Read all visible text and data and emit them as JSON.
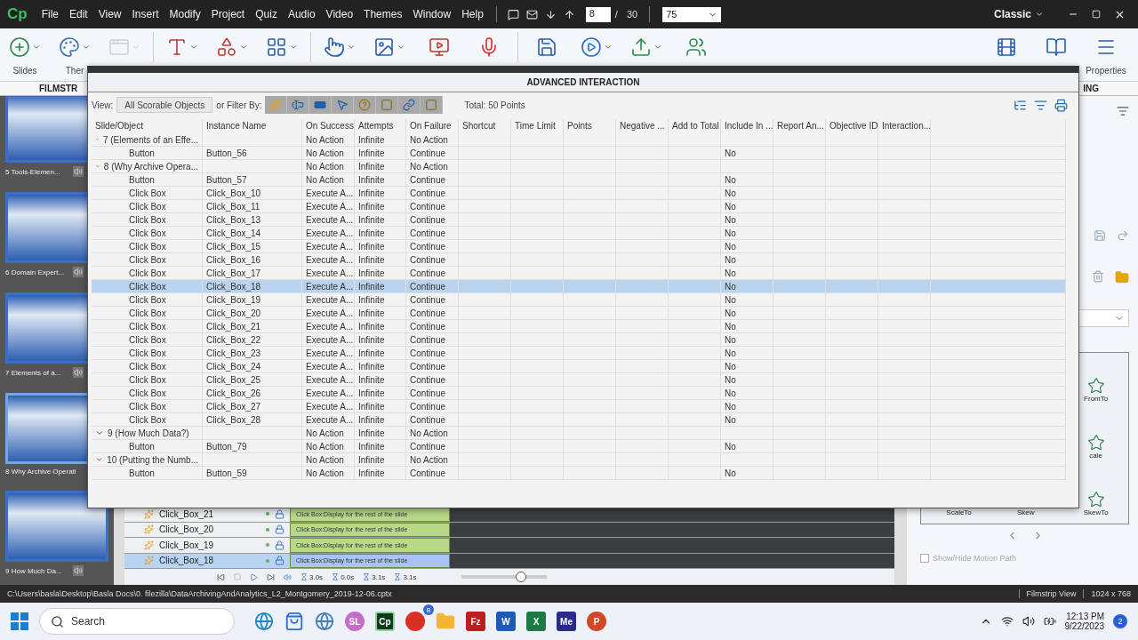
{
  "menu_bar": {
    "logo": "Cp",
    "menus": [
      "File",
      "Edit",
      "View",
      "Insert",
      "Modify",
      "Project",
      "Quiz",
      "Audio",
      "Video",
      "Themes",
      "Window",
      "Help"
    ],
    "page": "8",
    "page_separator": "/",
    "page_total": "30",
    "zoom": "75",
    "workspace": "Classic"
  },
  "toolbar": {
    "items": [
      {
        "kind": "slides",
        "label": "Slides",
        "caret": true,
        "disabled": false
      },
      {
        "kind": "themes",
        "label": "Ther",
        "caret": true,
        "disabled": false
      },
      {
        "kind": "window",
        "caret": true,
        "disabled": true
      },
      {
        "kind": "text",
        "caret": true,
        "disabled": false
      },
      {
        "kind": "shapes",
        "caret": true,
        "disabled": false
      },
      {
        "kind": "grid",
        "caret": true,
        "disabled": false
      },
      {
        "kind": "interactions",
        "caret": true,
        "disabled": false
      },
      {
        "kind": "media",
        "caret": true,
        "disabled": false
      },
      {
        "kind": "video",
        "caret": false,
        "disabled": false
      },
      {
        "kind": "audio",
        "caret": false,
        "disabled": false
      },
      {
        "kind": "save",
        "caret": false,
        "disabled": false
      },
      {
        "kind": "preview",
        "caret": true,
        "disabled": false
      },
      {
        "kind": "publish",
        "caret": true,
        "disabled": false
      },
      {
        "kind": "share",
        "caret": false,
        "disabled": false
      }
    ],
    "right_items": [
      {
        "kind": "library"
      },
      {
        "kind": "assets"
      },
      {
        "kind": "properties",
        "label": "Properties"
      }
    ]
  },
  "panel_headers": {
    "left": "FILMSTR",
    "right": "ING"
  },
  "filmstrip": [
    {
      "label": "5 Tools-Elemen...",
      "selected": false,
      "speaker": true
    },
    {
      "label": "6 Domain Expert...",
      "selected": false,
      "speaker": true
    },
    {
      "label": "7 Elements of a...",
      "selected": false,
      "speaker": true
    },
    {
      "label": "8 Why Archive Operati",
      "selected": true,
      "speaker": false
    },
    {
      "label": "9 How Much Da...",
      "selected": false,
      "speaker": true
    }
  ],
  "dialog": {
    "title": "ADVANCED INTERACTION",
    "view_label": "View:",
    "view_value": "All Scorable Objects",
    "filter_label": "or Filter By:",
    "filters": [
      {
        "kind": "click"
      },
      {
        "kind": "field"
      },
      {
        "kind": "button"
      },
      {
        "kind": "rollover"
      },
      {
        "kind": "question"
      },
      {
        "kind": "frame"
      },
      {
        "kind": "link"
      },
      {
        "kind": "frame"
      }
    ],
    "total": "Total: 50 Points",
    "columns": [
      "Slide/Object",
      "Instance Name",
      "On Success",
      "Attempts",
      "On Failure",
      "Shortcut",
      "Time Limit",
      "Points",
      "Negative ...",
      "Add to Total",
      "Include In ...",
      "Report An...",
      "Objective ID",
      "Interaction..."
    ],
    "groups": [
      {
        "label": "7 (Elements of an Effe...",
        "on_success": "No Action",
        "attempts": "Infinite",
        "on_failure": "No Action",
        "expanded": true,
        "children": [
          {
            "object": "Button",
            "instance": "Button_56",
            "on_success": "No Action",
            "attempts": "Infinite",
            "on_failure": "Continue",
            "include_in": "No",
            "selected": false
          }
        ]
      },
      {
        "label": "8 (Why Archive Opera...",
        "on_success": "No Action",
        "attempts": "Infinite",
        "on_failure": "No Action",
        "expanded": true,
        "children": [
          {
            "object": "Button",
            "instance": "Button_57",
            "on_success": "No Action",
            "attempts": "Infinite",
            "on_failure": "Continue",
            "include_in": "No",
            "selected": false
          },
          {
            "object": "Click Box",
            "instance": "Click_Box_10",
            "on_success": "Execute A...",
            "attempts": "Infinite",
            "on_failure": "Continue",
            "include_in": "No",
            "selected": false
          },
          {
            "object": "Click Box",
            "instance": "Click_Box_11",
            "on_success": "Execute A...",
            "attempts": "Infinite",
            "on_failure": "Continue",
            "include_in": "No",
            "selected": false
          },
          {
            "object": "Click Box",
            "instance": "Click_Box_13",
            "on_success": "Execute A...",
            "attempts": "Infinite",
            "on_failure": "Continue",
            "include_in": "No",
            "selected": false
          },
          {
            "object": "Click Box",
            "instance": "Click_Box_14",
            "on_success": "Execute A...",
            "attempts": "Infinite",
            "on_failure": "Continue",
            "include_in": "No",
            "selected": false
          },
          {
            "object": "Click Box",
            "instance": "Click_Box_15",
            "on_success": "Execute A...",
            "attempts": "Infinite",
            "on_failure": "Continue",
            "include_in": "No",
            "selected": false
          },
          {
            "object": "Click Box",
            "instance": "Click_Box_16",
            "on_success": "Execute A...",
            "attempts": "Infinite",
            "on_failure": "Continue",
            "include_in": "No",
            "selected": false
          },
          {
            "object": "Click Box",
            "instance": "Click_Box_17",
            "on_success": "Execute A...",
            "attempts": "Infinite",
            "on_failure": "Continue",
            "include_in": "No",
            "selected": false
          },
          {
            "object": "Click Box",
            "instance": "Click_Box_18",
            "on_success": "Execute A...",
            "attempts": "Infinite",
            "on_failure": "Continue",
            "include_in": "No",
            "selected": true
          },
          {
            "object": "Click Box",
            "instance": "Click_Box_19",
            "on_success": "Execute A...",
            "attempts": "Infinite",
            "on_failure": "Continue",
            "include_in": "No",
            "selected": false
          },
          {
            "object": "Click Box",
            "instance": "Click_Box_20",
            "on_success": "Execute A...",
            "attempts": "Infinite",
            "on_failure": "Continue",
            "include_in": "No",
            "selected": false
          },
          {
            "object": "Click Box",
            "instance": "Click_Box_21",
            "on_success": "Execute A...",
            "attempts": "Infinite",
            "on_failure": "Continue",
            "include_in": "No",
            "selected": false
          },
          {
            "object": "Click Box",
            "instance": "Click_Box_22",
            "on_success": "Execute A...",
            "attempts": "Infinite",
            "on_failure": "Continue",
            "include_in": "No",
            "selected": false
          },
          {
            "object": "Click Box",
            "instance": "Click_Box_23",
            "on_success": "Execute A...",
            "attempts": "Infinite",
            "on_failure": "Continue",
            "include_in": "No",
            "selected": false
          },
          {
            "object": "Click Box",
            "instance": "Click_Box_24",
            "on_success": "Execute A...",
            "attempts": "Infinite",
            "on_failure": "Continue",
            "include_in": "No",
            "selected": false
          },
          {
            "object": "Click Box",
            "instance": "Click_Box_25",
            "on_success": "Execute A...",
            "attempts": "Infinite",
            "on_failure": "Continue",
            "include_in": "No",
            "selected": false
          },
          {
            "object": "Click Box",
            "instance": "Click_Box_26",
            "on_success": "Execute A...",
            "attempts": "Infinite",
            "on_failure": "Continue",
            "include_in": "No",
            "selected": false
          },
          {
            "object": "Click Box",
            "instance": "Click_Box_27",
            "on_success": "Execute A...",
            "attempts": "Infinite",
            "on_failure": "Continue",
            "include_in": "No",
            "selected": false
          },
          {
            "object": "Click Box",
            "instance": "Click_Box_28",
            "on_success": "Execute A...",
            "attempts": "Infinite",
            "on_failure": "Continue",
            "include_in": "No",
            "selected": false
          }
        ]
      },
      {
        "label": "9 (How Much Data?)",
        "on_success": "No Action",
        "attempts": "Infinite",
        "on_failure": "No Action",
        "expanded": true,
        "children": [
          {
            "object": "Button",
            "instance": "Button_79",
            "on_success": "No Action",
            "attempts": "Infinite",
            "on_failure": "Continue",
            "include_in": "No",
            "selected": false
          }
        ]
      },
      {
        "label": "10 (Putting the Numb...",
        "on_success": "No Action",
        "attempts": "Infinite",
        "on_failure": "No Action",
        "expanded": true,
        "children": [
          {
            "object": "Button",
            "instance": "Button_59",
            "on_success": "No Action",
            "attempts": "Infinite",
            "on_failure": "Continue",
            "include_in": "No",
            "selected": false
          }
        ]
      }
    ]
  },
  "timeline": {
    "rows": [
      {
        "name": "Click_Box_21",
        "bar": "Click Box:Display for the rest of the slide",
        "selected": false
      },
      {
        "name": "Click_Box_20",
        "bar": "Click Box:Display for the rest of the slide",
        "selected": false
      },
      {
        "name": "Click_Box_19",
        "bar": "Click Box:Display for the rest of the slide",
        "selected": false
      },
      {
        "name": "Click_Box_18",
        "bar": "Click Box:Display for the rest of the slide",
        "selected": true
      }
    ],
    "times": [
      "3.0s",
      "0.0s",
      "3.1s",
      "3.1s"
    ],
    "level": 0.7
  },
  "effects": {
    "items": [
      "FromTo",
      "cale",
      "ScaleTo",
      "Skew",
      "SkewTo"
    ],
    "motion_path": {
      "label": "Show/Hide Motion Path",
      "checked": false,
      "disabled": true
    }
  },
  "status_bar": {
    "path": "C:\\Users\\basla\\Desktop\\Basla Docs\\0. filezilla\\DataArchivingAndAnalytics_L2_Montgomery_2019-12-06.cptx",
    "view": "Filmstrip View",
    "size": "1024 x 768"
  },
  "taskbar": {
    "search": "Search",
    "apps": [
      {
        "kind": "browser",
        "color": "#1e88c8"
      },
      {
        "kind": "store",
        "color": "#2a6fd6"
      },
      {
        "kind": "globe",
        "color": "#3f7fbf"
      },
      {
        "kind": "circle",
        "label": "SL",
        "color": "#c86ac8"
      },
      {
        "kind": "tile",
        "label": "Cp",
        "color": "#0b3b1a",
        "selected": true
      },
      {
        "kind": "chrome",
        "color": "#d93025",
        "badge": "B"
      },
      {
        "kind": "folder",
        "color": "#f2b632"
      },
      {
        "kind": "tile",
        "label": "Fz",
        "color": "#bf1e1e"
      },
      {
        "kind": "tile",
        "label": "W",
        "color": "#1f5bb5"
      },
      {
        "kind": "tile",
        "label": "X",
        "color": "#1d7a44"
      },
      {
        "kind": "tile",
        "label": "Me",
        "color": "#2a2a8c"
      },
      {
        "kind": "circle",
        "label": "P",
        "color": "#d24726"
      }
    ],
    "time": "12:13 PM",
    "date": "9/22/2023",
    "notifications": "2"
  }
}
